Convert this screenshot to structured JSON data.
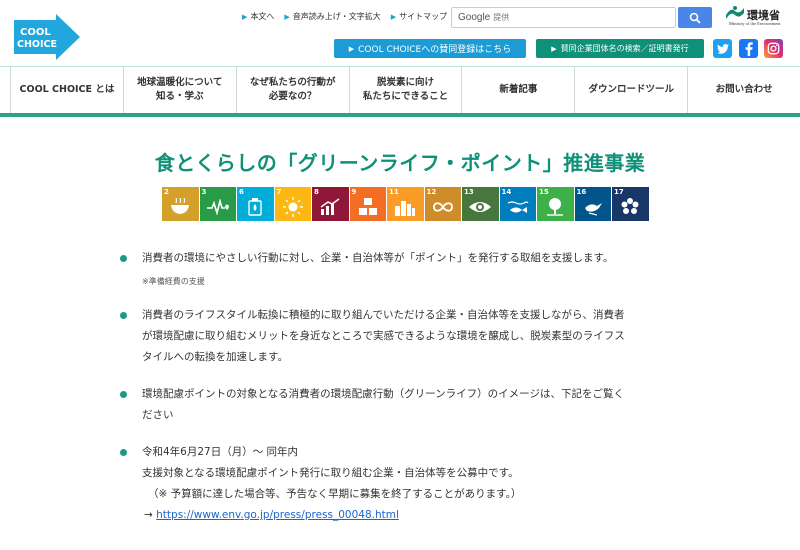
{
  "header": {
    "logo_line1": "COOL",
    "logo_line2": "CHOICE",
    "utility_links": [
      "本文へ",
      "音声読み上げ・文字拡大",
      "サイトマップ"
    ],
    "search": {
      "brand": "Google",
      "placeholder": "提供"
    },
    "ministry": {
      "name": "環境省",
      "sub": "Ministry of the Environment"
    },
    "cta_register": "COOL CHOICEへの賛同登録はこちら",
    "cta_search": "賛同企業団体名の検索／証明書発行"
  },
  "nav": {
    "items": [
      {
        "label": "COOL CHOICE とは"
      },
      {
        "label1": "地球温暖化について",
        "label2": "知る・学ぶ"
      },
      {
        "label1": "なぜ私たちの行動が",
        "label2": "必要なの？"
      },
      {
        "label1": "脱炭素に向け",
        "label2": "私たちにできること"
      },
      {
        "label": "新着記事"
      },
      {
        "label": "ダウンロードツール"
      },
      {
        "label": "お問い合わせ"
      }
    ]
  },
  "main": {
    "title": "食とくらしの「グリーンライフ・ポイント」推進事業",
    "sdg_goals": [
      {
        "num": "2",
        "color": "#d3a029",
        "icon": "bowl-icon"
      },
      {
        "num": "3",
        "color": "#279b48",
        "icon": "heartbeat-icon"
      },
      {
        "num": "6",
        "color": "#00aed9",
        "icon": "water-drop-icon"
      },
      {
        "num": "7",
        "color": "#fdb713",
        "icon": "sun-icon"
      },
      {
        "num": "8",
        "color": "#8f1838",
        "icon": "growth-chart-icon"
      },
      {
        "num": "9",
        "color": "#f36d25",
        "icon": "cubes-icon"
      },
      {
        "num": "11",
        "color": "#f99d26",
        "icon": "city-icon"
      },
      {
        "num": "12",
        "color": "#cf8d2a",
        "icon": "infinity-icon"
      },
      {
        "num": "13",
        "color": "#48773e",
        "icon": "eye-globe-icon"
      },
      {
        "num": "14",
        "color": "#007dbc",
        "icon": "fish-icon"
      },
      {
        "num": "15",
        "color": "#3eb049",
        "icon": "tree-icon"
      },
      {
        "num": "16",
        "color": "#02558b",
        "icon": "dove-icon"
      },
      {
        "num": "17",
        "color": "#183668",
        "icon": "flower-icon"
      }
    ],
    "bullets": [
      {
        "lines": [
          "消費者の環境にやさしい行動に対し、企業・自治体等が「ポイント」を発行する取組を支援します。"
        ],
        "note": "※準備経費の支援"
      },
      {
        "lines": [
          "消費者のライフスタイル転換に積極的に取り組んでいただける企業・自治体等を支援しながら、消費者",
          "が環境配慮に取り組むメリットを身近なところで実感できるような環境を醸成し、脱炭素型のライフス",
          "タイルへの転換を加速します。"
        ]
      },
      {
        "lines": [
          "環境配慮ポイントの対象となる消費者の環境配慮行動（グリーンライフ）のイメージは、下記をご覧く",
          "ださい"
        ]
      },
      {
        "lines": [
          "令和4年6月27日（月）〜 同年内",
          "支援対象となる環境配慮ポイント発行に取り組む企業・自治体等を公募中です。",
          "（※ 予算額に達した場合等、予告なく早期に募集を終了することがあります。）"
        ],
        "link_prefix": "→ ",
        "link_text": "https://www.env.go.jp/press/press_00048.html"
      }
    ]
  }
}
